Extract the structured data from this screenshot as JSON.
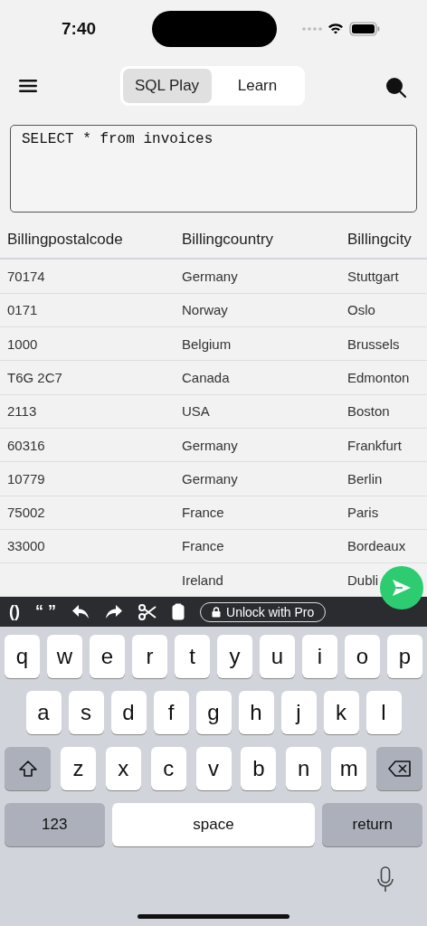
{
  "status_bar": {
    "time": "7:40"
  },
  "segments": [
    {
      "label": "SQL Play",
      "selected": true
    },
    {
      "label": "Learn",
      "selected": false
    }
  ],
  "query": {
    "value": "SELECT * from invoices"
  },
  "table": {
    "columns": [
      "Billingpostalcode",
      "Billingcountry",
      "Billingcity"
    ],
    "rows": [
      [
        "70174",
        "Germany",
        "Stuttgart"
      ],
      [
        "0171",
        "Norway",
        "Oslo"
      ],
      [
        "1000",
        "Belgium",
        "Brussels"
      ],
      [
        "T6G 2C7",
        "Canada",
        "Edmonton"
      ],
      [
        "2113",
        "USA",
        "Boston"
      ],
      [
        "60316",
        "Germany",
        "Frankfurt"
      ],
      [
        "10779",
        "Germany",
        "Berlin"
      ],
      [
        "75002",
        "France",
        "Paris"
      ],
      [
        "33000",
        "France",
        "Bordeaux"
      ],
      [
        "",
        "Ireland",
        "Dubli"
      ]
    ]
  },
  "toolbar": {
    "items": [
      {
        "kind": "text",
        "label": "()"
      },
      {
        "kind": "text",
        "label": "“ ”"
      },
      {
        "kind": "undo"
      },
      {
        "kind": "redo"
      },
      {
        "kind": "cut"
      },
      {
        "kind": "paste"
      }
    ],
    "pro_button": "Unlock with Pro"
  },
  "keyboard": {
    "rows": [
      {
        "keys": [
          {
            "kind": "letter",
            "label": "q"
          },
          {
            "kind": "letter",
            "label": "w"
          },
          {
            "kind": "letter",
            "label": "e"
          },
          {
            "kind": "letter",
            "label": "r"
          },
          {
            "kind": "letter",
            "label": "t"
          },
          {
            "kind": "letter",
            "label": "y"
          },
          {
            "kind": "letter",
            "label": "u"
          },
          {
            "kind": "letter",
            "label": "i"
          },
          {
            "kind": "letter",
            "label": "o"
          },
          {
            "kind": "letter",
            "label": "p"
          }
        ]
      },
      {
        "keys": [
          {
            "kind": "letter",
            "label": "a"
          },
          {
            "kind": "letter",
            "label": "s"
          },
          {
            "kind": "letter",
            "label": "d"
          },
          {
            "kind": "letter",
            "label": "f"
          },
          {
            "kind": "letter",
            "label": "g"
          },
          {
            "kind": "letter",
            "label": "h"
          },
          {
            "kind": "letter",
            "label": "j"
          },
          {
            "kind": "letter",
            "label": "k"
          },
          {
            "kind": "letter",
            "label": "l"
          }
        ]
      },
      {
        "keys": [
          {
            "kind": "shift"
          },
          {
            "kind": "letter",
            "label": "z"
          },
          {
            "kind": "letter",
            "label": "x"
          },
          {
            "kind": "letter",
            "label": "c"
          },
          {
            "kind": "letter",
            "label": "v"
          },
          {
            "kind": "letter",
            "label": "b"
          },
          {
            "kind": "letter",
            "label": "n"
          },
          {
            "kind": "letter",
            "label": "m"
          },
          {
            "kind": "delete"
          }
        ]
      },
      {
        "keys": [
          {
            "kind": "wide",
            "label": "123"
          },
          {
            "kind": "space",
            "label": "space"
          },
          {
            "kind": "wide",
            "label": "return"
          }
        ]
      }
    ]
  }
}
